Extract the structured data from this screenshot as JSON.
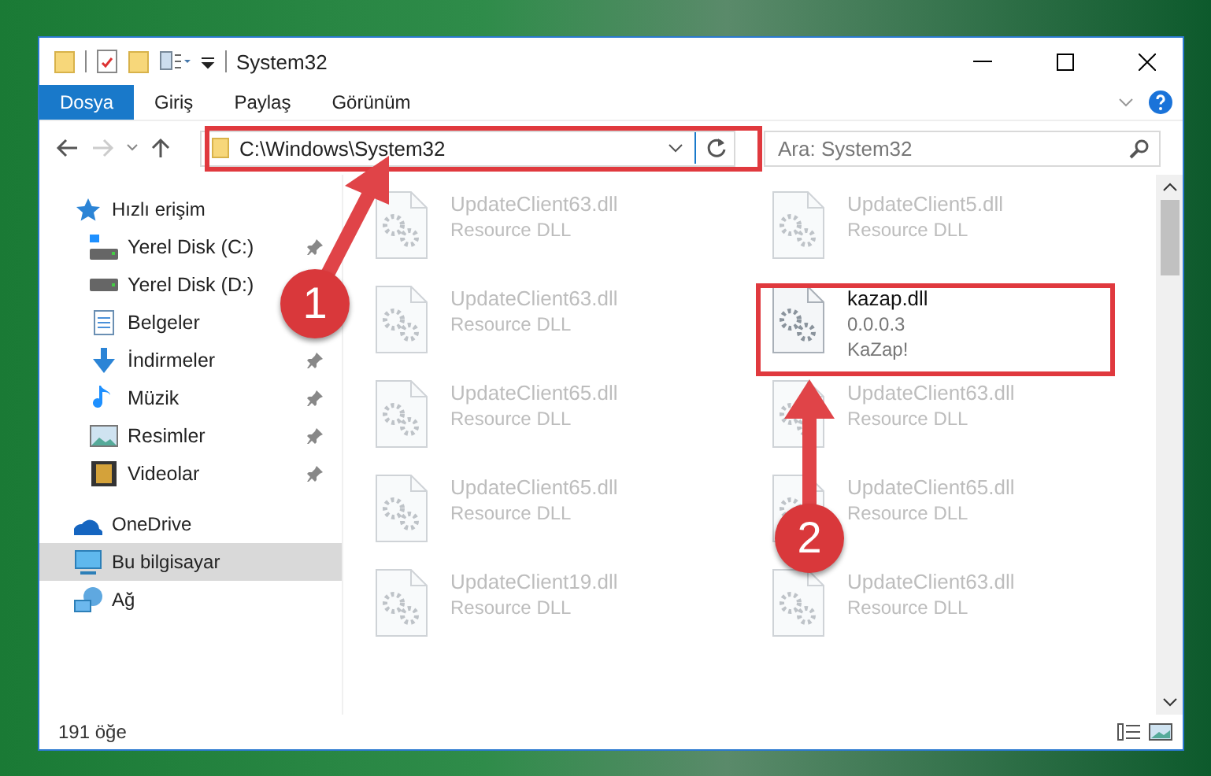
{
  "window": {
    "title": "System32"
  },
  "ribbon_tabs": [
    {
      "label": "Dosya",
      "selected": true
    },
    {
      "label": "Giriş",
      "selected": false
    },
    {
      "label": "Paylaş",
      "selected": false
    },
    {
      "label": "Görünüm",
      "selected": false
    }
  ],
  "address_bar": {
    "path": "C:\\Windows\\System32"
  },
  "search": {
    "placeholder": "Ara: System32"
  },
  "sidebar": {
    "items": [
      {
        "label": "Hızlı erişim",
        "kind": "star",
        "selected": false,
        "children": [
          {
            "label": "Yerel Disk (C:)",
            "kind": "system-drive",
            "pinned": true,
            "selected": false
          },
          {
            "label": "Yerel Disk (D:)",
            "kind": "drive",
            "pinned": false,
            "selected": false
          },
          {
            "label": "Belgeler",
            "kind": "documents",
            "pinned": false,
            "selected": false
          },
          {
            "label": "İndirmeler",
            "kind": "downloads",
            "pinned": true,
            "selected": false
          },
          {
            "label": "Müzik",
            "kind": "music",
            "pinned": true,
            "selected": false
          },
          {
            "label": "Resimler",
            "kind": "pictures",
            "pinned": true,
            "selected": false
          },
          {
            "label": "Videolar",
            "kind": "videos",
            "pinned": true,
            "selected": false
          }
        ]
      },
      {
        "label": "OneDrive",
        "kind": "cloud",
        "selected": false
      },
      {
        "label": "Bu bilgisayar",
        "kind": "computer",
        "selected": true
      },
      {
        "label": "Ağ",
        "kind": "network",
        "selected": false
      }
    ]
  },
  "files": [
    {
      "name": "UpdateClient63.dll",
      "lines": [
        "Resource DLL"
      ],
      "faded": true
    },
    {
      "name": "UpdateClient5.dll",
      "lines": [
        "Resource DLL"
      ],
      "faded": true
    },
    {
      "name": "UpdateClient63.dll",
      "lines": [
        "Resource DLL"
      ],
      "faded": true
    },
    {
      "name": "kazap.dll",
      "lines": [
        "0.0.0.3",
        "KaZap!"
      ],
      "faded": false
    },
    {
      "name": "UpdateClient65.dll",
      "lines": [
        "Resource DLL"
      ],
      "faded": true
    },
    {
      "name": "UpdateClient63.dll",
      "lines": [
        "Resource DLL"
      ],
      "faded": true
    },
    {
      "name": "UpdateClient65.dll",
      "lines": [
        "Resource DLL"
      ],
      "faded": true
    },
    {
      "name": "UpdateClient65.dll",
      "lines": [
        "Resource DLL"
      ],
      "faded": true
    },
    {
      "name": "UpdateClient19.dll",
      "lines": [
        "Resource DLL"
      ],
      "faded": true
    },
    {
      "name": "UpdateClient63.dll",
      "lines": [
        "Resource DLL"
      ],
      "faded": true
    }
  ],
  "status_bar": {
    "item_count": "191 öğe"
  },
  "annotations": [
    {
      "number": "1"
    },
    {
      "number": "2"
    }
  ]
}
